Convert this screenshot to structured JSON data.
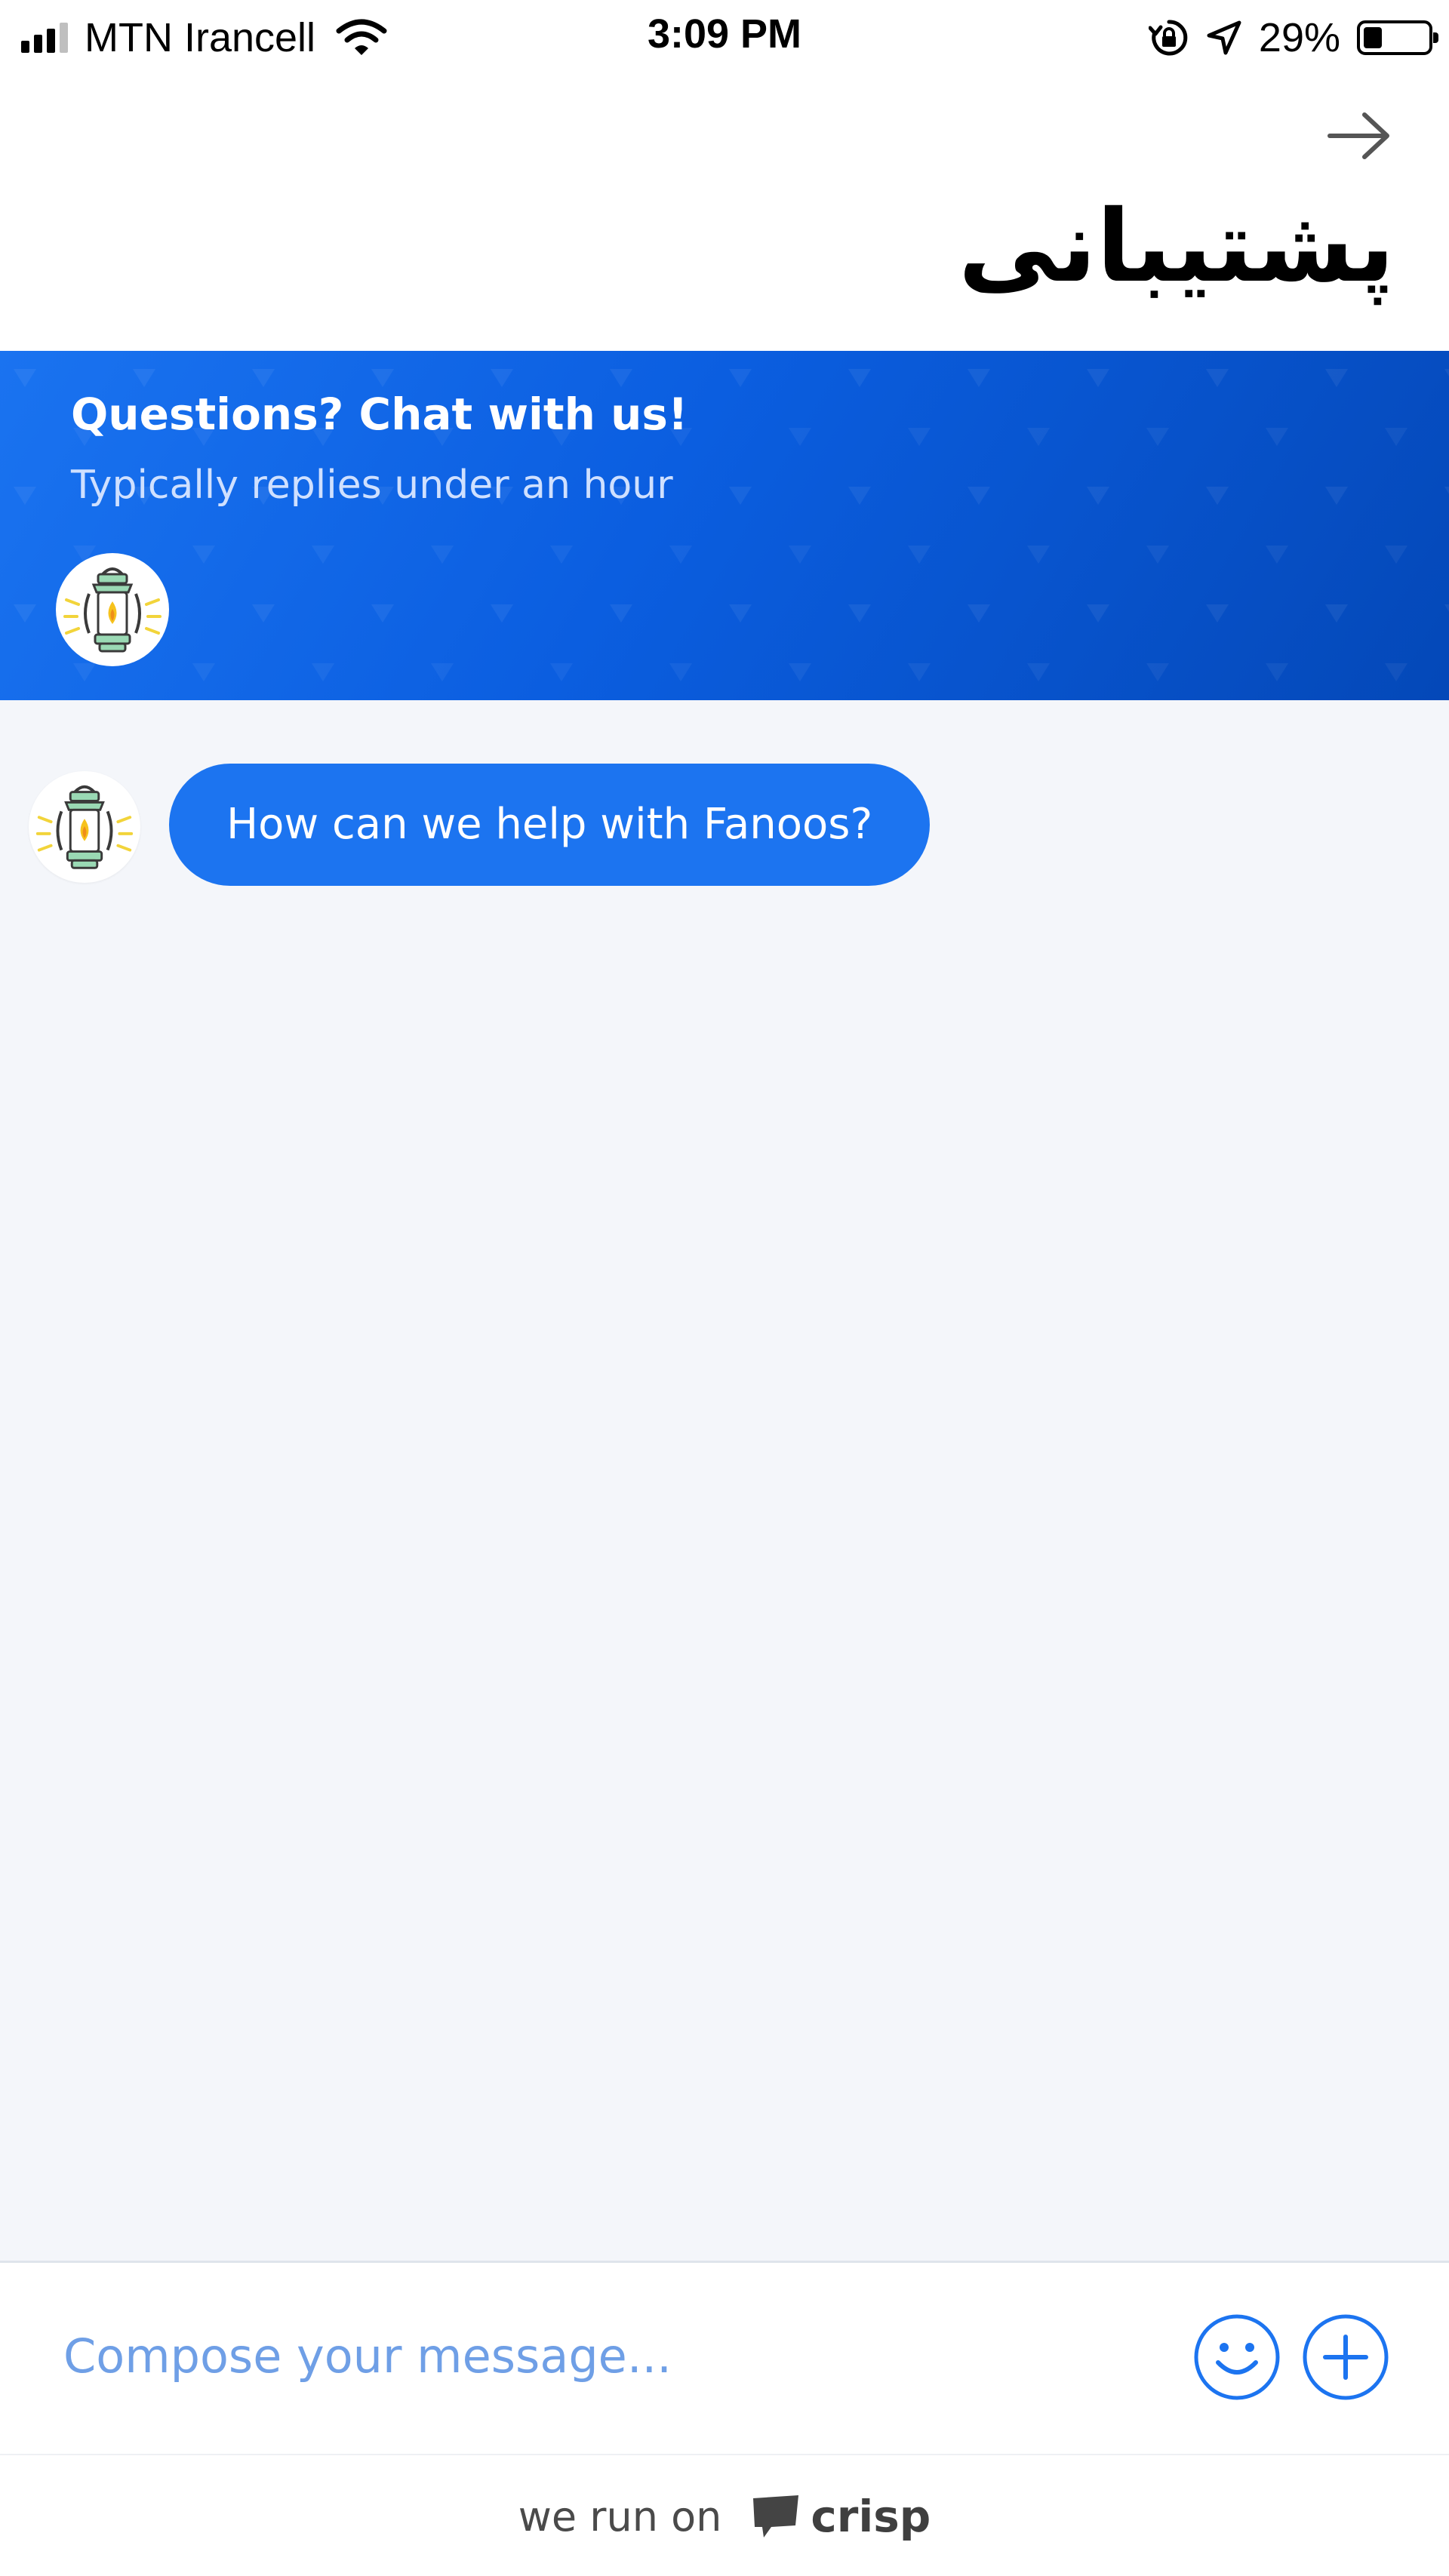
{
  "status_bar": {
    "carrier": "MTN Irancell",
    "time": "3:09 PM",
    "battery": "29%",
    "battery_level": 0.29,
    "icons": [
      "signal-icon",
      "wifi-icon",
      "rotation-lock-icon",
      "location-icon",
      "battery-icon"
    ]
  },
  "header": {
    "back_icon": "arrow-right-icon",
    "title": "پشتیبانی"
  },
  "banner": {
    "title": "Questions? Chat with us!",
    "subtitle": "Typically replies under an hour",
    "avatar_icon": "lantern-icon"
  },
  "chat": {
    "messages": [
      {
        "sender_icon": "lantern-icon",
        "text": "How can we help with Fanoos?"
      }
    ]
  },
  "compose": {
    "placeholder": "Compose your message...",
    "emoji_icon": "smiley-icon",
    "attach_icon": "plus-circle-icon"
  },
  "footer": {
    "text": "we run on",
    "brand": "crisp",
    "brand_icon": "crisp-chat-icon"
  },
  "colors": {
    "accent": "#1c74f0",
    "banner_dark": "#0448b8",
    "chat_bg": "#f4f6fa"
  }
}
